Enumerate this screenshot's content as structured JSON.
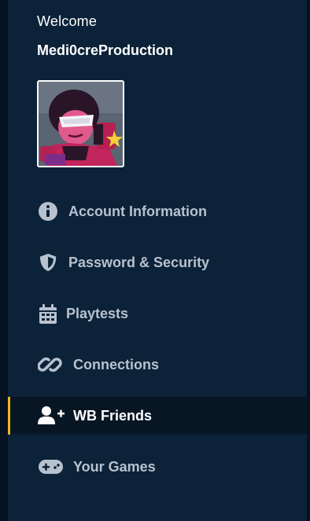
{
  "header": {
    "welcome": "Welcome",
    "username": "Medi0creProduction"
  },
  "avatar": {
    "alt": "Profile avatar"
  },
  "nav": {
    "items": [
      {
        "label": "Account Information",
        "icon": "info-circle-icon"
      },
      {
        "label": "Password & Security",
        "icon": "shield-icon"
      },
      {
        "label": "Playtests",
        "icon": "calendar-icon"
      },
      {
        "label": "Connections",
        "icon": "link-icon"
      },
      {
        "label": "WB Friends",
        "icon": "user-plus-icon",
        "active": true
      },
      {
        "label": "Your Games",
        "icon": "gamepad-icon"
      }
    ]
  },
  "colors": {
    "sidebar_bg": "#0b2238",
    "active_bg": "#081624",
    "active_accent": "#f5b321",
    "item_text": "#b8c2cf",
    "active_text": "#ffffff"
  }
}
